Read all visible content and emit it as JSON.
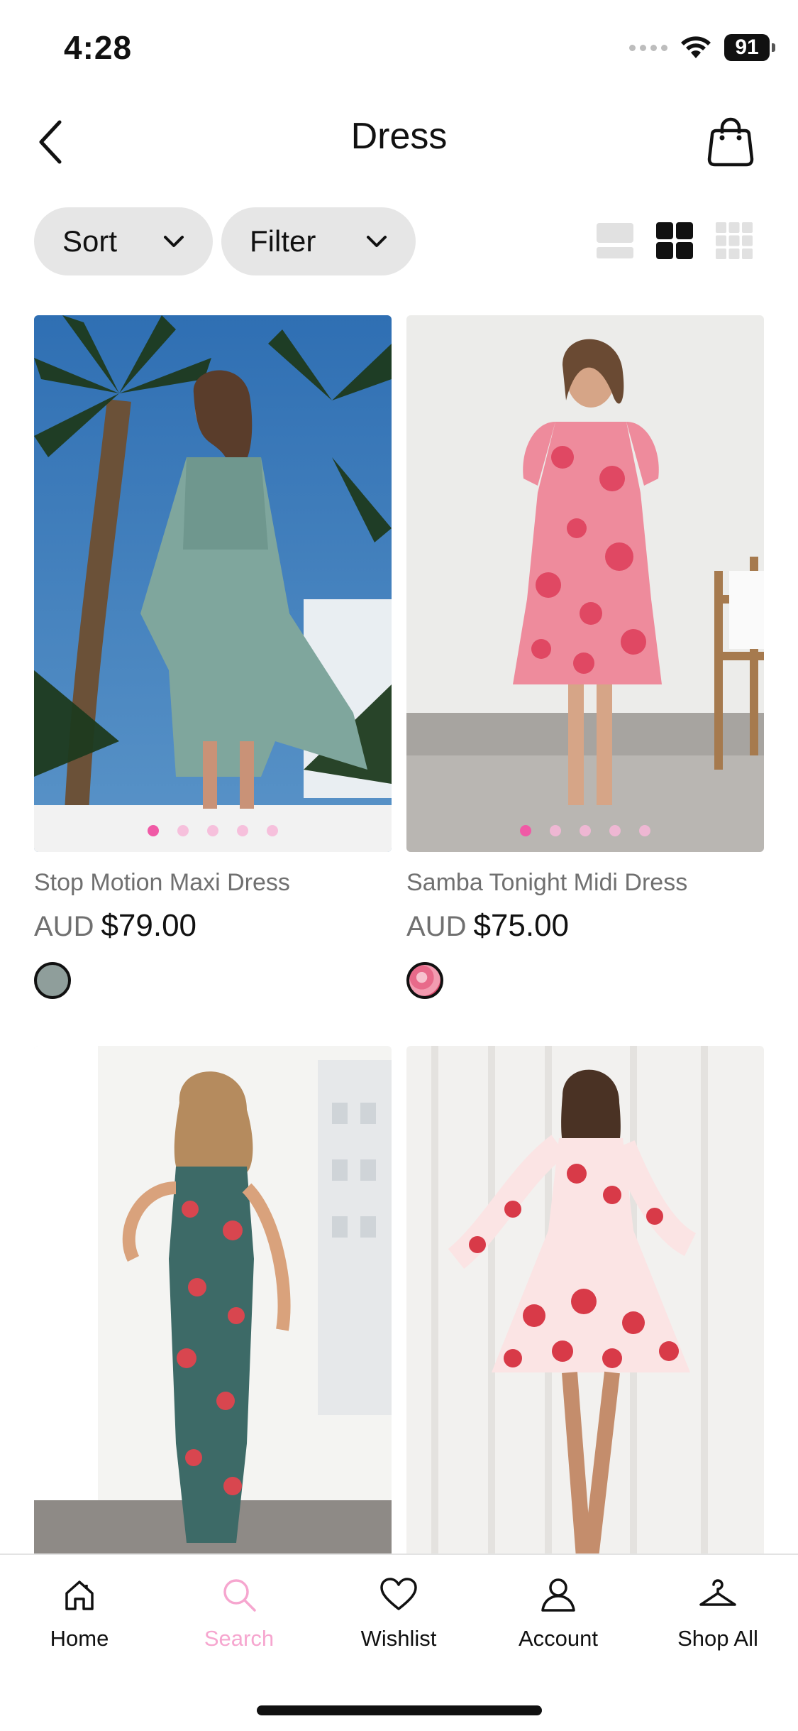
{
  "status_bar": {
    "time": "4:28",
    "battery": "91",
    "icons": [
      "signal-icon",
      "wifi-icon",
      "battery-icon"
    ]
  },
  "header": {
    "title": "Dress",
    "back_icon": "back-chevron-icon",
    "bag_icon": "shopping-bag-icon"
  },
  "controls": {
    "sort_label": "Sort",
    "filter_label": "Filter",
    "view_modes": [
      "list-view-icon",
      "grid-2-view-icon",
      "grid-3-view-icon"
    ],
    "active_view": "grid-2-view-icon"
  },
  "products": [
    {
      "name": "Stop Motion Maxi Dress",
      "currency": "AUD",
      "price": "$79.00",
      "swatch_color": "#8f9e9b",
      "image_count": 5,
      "active_image": 1
    },
    {
      "name": "Samba Tonight Midi Dress",
      "currency": "AUD",
      "price": "$75.00",
      "swatch_color": "#e86a8a",
      "image_count": 5,
      "active_image": 1
    },
    {
      "name": "",
      "currency": "",
      "price": ""
    },
    {
      "name": "",
      "currency": "",
      "price": ""
    }
  ],
  "bottom_nav": {
    "items": [
      {
        "label": "Home",
        "icon": "home-icon"
      },
      {
        "label": "Search",
        "icon": "search-icon"
      },
      {
        "label": "Wishlist",
        "icon": "heart-icon"
      },
      {
        "label": "Account",
        "icon": "user-icon"
      },
      {
        "label": "Shop All",
        "icon": "hanger-icon"
      }
    ],
    "active": "Search"
  },
  "colors": {
    "accent_pink": "#f6a6cf",
    "dot_pink": "#f05aa6",
    "pill_bg": "#e6e6e6"
  }
}
